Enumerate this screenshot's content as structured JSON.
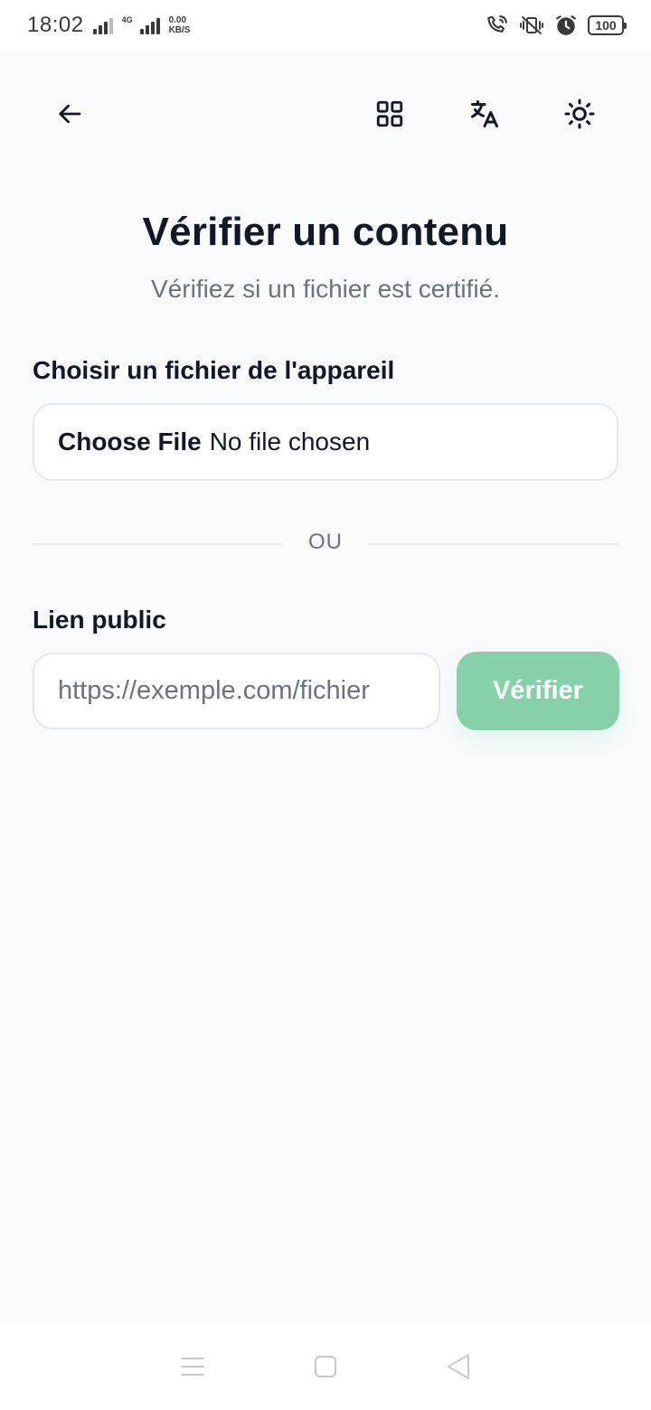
{
  "status_bar": {
    "time": "18:02",
    "network_type": "4G",
    "speed_value": "0.00",
    "speed_unit": "KB/S",
    "battery": "100"
  },
  "app_bar": {
    "icons": [
      "back-arrow-icon",
      "qr-code-icon",
      "translate-icon",
      "sun-icon"
    ]
  },
  "page": {
    "title": "Vérifier un contenu",
    "subtitle": "Vérifiez si un fichier est certifié."
  },
  "file_section": {
    "label": "Choisir un fichier de l'appareil",
    "choose_button": "Choose File",
    "status": "No file chosen"
  },
  "divider": {
    "text": "OU"
  },
  "link_section": {
    "label": "Lien public",
    "placeholder": "https://exemple.com/fichier",
    "value": "",
    "verify_button": "Vérifier",
    "verify_button_color": "#86d1aa"
  },
  "nav_bar": {
    "icons": [
      "menu-icon",
      "home-square-icon",
      "back-triangle-icon"
    ]
  }
}
